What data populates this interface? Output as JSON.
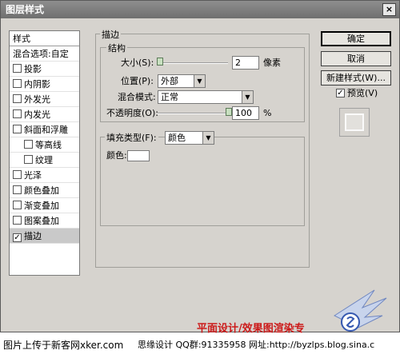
{
  "window": {
    "title": "图层样式",
    "close": "×"
  },
  "style_list": {
    "header": "样式",
    "items": [
      {
        "label": "混合选项:自定",
        "checkbox": false,
        "indent": false,
        "checked": false
      },
      {
        "label": "投影",
        "checkbox": true,
        "indent": false,
        "checked": false
      },
      {
        "label": "内阴影",
        "checkbox": true,
        "indent": false,
        "checked": false
      },
      {
        "label": "外发光",
        "checkbox": true,
        "indent": false,
        "checked": false
      },
      {
        "label": "内发光",
        "checkbox": true,
        "indent": false,
        "checked": false
      },
      {
        "label": "斜面和浮雕",
        "checkbox": true,
        "indent": false,
        "checked": false
      },
      {
        "label": "等高线",
        "checkbox": true,
        "indent": true,
        "checked": false
      },
      {
        "label": "纹理",
        "checkbox": true,
        "indent": true,
        "checked": false
      },
      {
        "label": "光泽",
        "checkbox": true,
        "indent": false,
        "checked": false
      },
      {
        "label": "颜色叠加",
        "checkbox": true,
        "indent": false,
        "checked": false
      },
      {
        "label": "渐变叠加",
        "checkbox": true,
        "indent": false,
        "checked": false
      },
      {
        "label": "图案叠加",
        "checkbox": true,
        "indent": false,
        "checked": false
      },
      {
        "label": "描边",
        "checkbox": true,
        "indent": false,
        "checked": true,
        "selected": true
      }
    ]
  },
  "stroke": {
    "group_title": "描边",
    "structure_title": "结构",
    "size_label": "大小(S):",
    "size_value": "2",
    "size_unit": "像素",
    "position_label": "位置(P):",
    "position_value": "外部",
    "blend_label": "混合模式:",
    "blend_value": "正常",
    "opacity_label": "不透明度(O):",
    "opacity_value": "100",
    "opacity_unit": "%",
    "fill_type_label": "填充类型(F):",
    "fill_type_value": "颜色",
    "color_label": "颜色:",
    "color_value": "#ffffff"
  },
  "buttons": {
    "ok": "确定",
    "cancel": "取消",
    "new_style": "新建样式(W)...",
    "preview_label": "预览(V)",
    "preview_checked": "✓"
  },
  "watermark": {
    "red_text": "平面设计/效果图渲染专",
    "left_text": "图片上传于新客网xker.com",
    "center_text": "思缘设计 QQ群:91335958 网址:http://byzlps.blog.sina.c"
  }
}
